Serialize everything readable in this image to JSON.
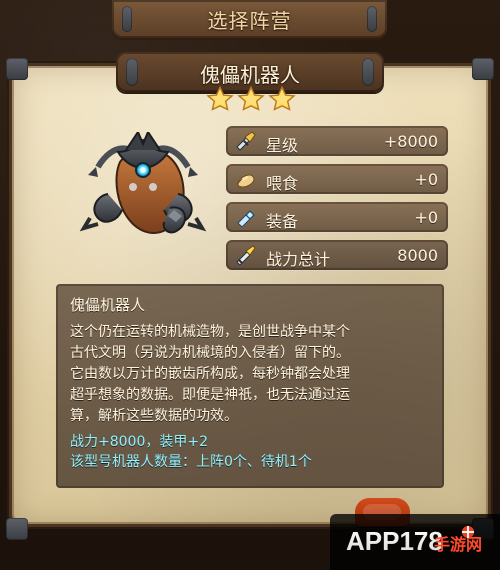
{
  "header": {
    "title": "选择阵营"
  },
  "unit": {
    "name": "傀儡机器人",
    "stars": 3
  },
  "stats": [
    {
      "label": "星级",
      "value": "+8000",
      "icon": "sword-icon"
    },
    {
      "label": "喂食",
      "value": "+0",
      "icon": "food-icon"
    },
    {
      "label": "装备",
      "value": "+0",
      "icon": "equipment-icon"
    },
    {
      "label": "战力总计",
      "value": "8000",
      "icon": "sword-total-icon"
    }
  ],
  "description": {
    "title": "傀儡机器人",
    "lines": [
      "这个仍在运转的机械造物，是创世战争中某个",
      "古代文明（另说为机械境的入侵者）留下的。",
      "它由数以万计的嵌齿所构成，每秒钟都会处理",
      "超乎想象的数据。即便是神祇，也无法通过运",
      "算，解析这些数据的功效。"
    ],
    "green_lines": [
      "战力+8000，装甲+2",
      "该型号机器人数量：上阵0个、待机1个"
    ]
  },
  "watermark": {
    "text": "APP178手游网"
  },
  "colors": {
    "gold": "#ffd54a",
    "cyan_text": "#8ff0ff",
    "parchment": "#e8d7ad"
  }
}
